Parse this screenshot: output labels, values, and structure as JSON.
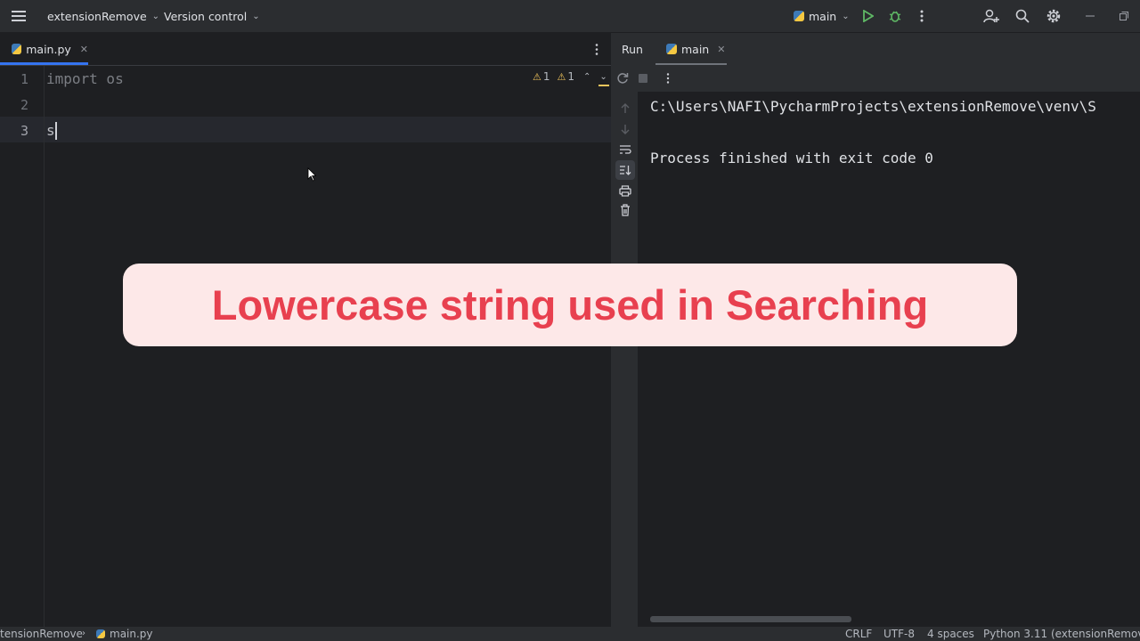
{
  "titlebar": {
    "menu_icon": "hamburger-icon",
    "project": "extensionRemove",
    "vcs": "Version control",
    "run_config": "main",
    "window_controls": [
      "minimize",
      "restore"
    ]
  },
  "editor": {
    "tab": "main.py",
    "lines": [
      {
        "num": "1",
        "text": "import os"
      },
      {
        "num": "2",
        "text": ""
      },
      {
        "num": "3",
        "text": "s"
      }
    ],
    "inspections": {
      "warnings_a": "1",
      "warnings_b": "1"
    }
  },
  "run": {
    "tab_run": "Run",
    "tab_main": "main",
    "output": [
      "C:\\Users\\NAFI\\PycharmProjects\\extensionRemove\\venv\\S",
      "",
      "Process finished with exit code 0"
    ]
  },
  "statusbar": {
    "path_project": "tensionRemove",
    "path_file": "main.py",
    "line_sep": "CRLF",
    "encoding": "UTF-8",
    "indent": "4 spaces",
    "interpreter": "Python 3.11 (extensionRemove)"
  },
  "overlay": {
    "caption": "Lowercase string used in Searching"
  },
  "colors": {
    "accent_blue": "#3574f0",
    "run_green": "#5fb865",
    "warning_yellow": "#f2c55c",
    "banner_text": "#e8404f",
    "banner_bg": "#fde8e8"
  }
}
